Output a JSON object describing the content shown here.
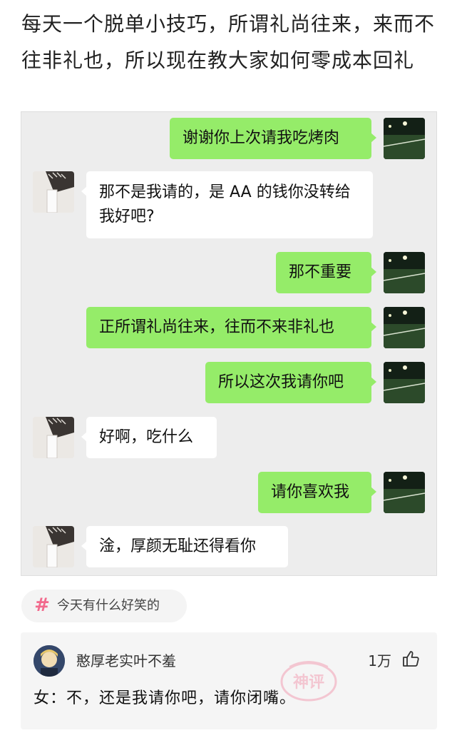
{
  "post": {
    "text": "每天一个脱单小技巧，所谓礼尚往来，来而不往非礼也，所以现在教大家如何零成本回礼"
  },
  "chat": {
    "messages": [
      {
        "from": "me",
        "text": "谢谢你上次请我吃烤肉"
      },
      {
        "from": "them",
        "text": "那不是我请的，是 AA 的钱你没转给我好吧?"
      },
      {
        "from": "me",
        "text": "那不重要"
      },
      {
        "from": "me",
        "text": "正所谓礼尚往来，往而不来非礼也"
      },
      {
        "from": "me",
        "text": "所以这次我请你吧"
      },
      {
        "from": "them",
        "text": "好啊，吃什么"
      },
      {
        "from": "me",
        "text": "请你喜欢我"
      },
      {
        "from": "them",
        "text": "淦，厚颜无耻还得看你"
      }
    ]
  },
  "hashtag": {
    "icon": "hash-icon",
    "label": "今天有什么好笑的",
    "color": "#f26a8d"
  },
  "comment": {
    "username": "憨厚老实叶不羞",
    "likes": "1万",
    "text": "女：不，还是我请你吧，请你闭嘴。",
    "stamp": "神评"
  },
  "colors": {
    "my_bubble": "#95ec69",
    "their_bubble": "#ffffff",
    "chat_bg": "#ededed"
  }
}
